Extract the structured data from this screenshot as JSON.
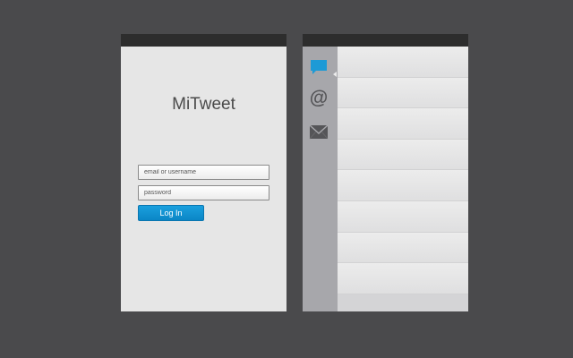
{
  "login": {
    "app_title": "MiTweet",
    "email_placeholder": "email or username",
    "password_placeholder": "password",
    "login_button": "Log In"
  },
  "feed": {
    "sidebar_icons": [
      "chat-bubble-icon",
      "at-sign-icon",
      "envelope-icon"
    ],
    "mentions_glyph": "@",
    "row_count": 8
  },
  "colors": {
    "background": "#4a4a4c",
    "screen": "#e6e6e6",
    "statusbar": "#2d2d2d",
    "accent": "#0e90d2",
    "sidebar": "#a7a7ab"
  }
}
